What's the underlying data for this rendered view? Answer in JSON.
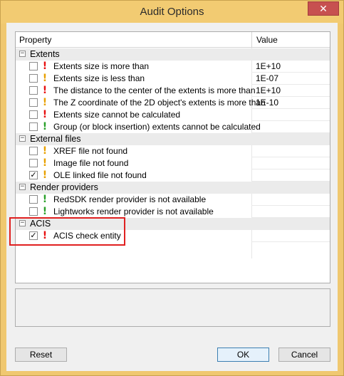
{
  "window": {
    "title": "Audit Options",
    "close_label": "✕"
  },
  "grid": {
    "columns": {
      "property": "Property",
      "value": "Value"
    },
    "groups": [
      {
        "label": "Extents",
        "expander": "−",
        "items": [
          {
            "label": "Extents size is more than",
            "value": "1E+10",
            "checked": "",
            "severity": "error"
          },
          {
            "label": "Extents size is less than",
            "value": "1E-07",
            "checked": "",
            "severity": "warning"
          },
          {
            "label": "The distance to the center of the extents is more than",
            "value": "1E+10",
            "checked": "",
            "severity": "error"
          },
          {
            "label": "The Z coordinate of the 2D object's extents is more than",
            "value": "1E-10",
            "checked": "",
            "severity": "warning"
          },
          {
            "label": "Extents size cannot be calculated",
            "value": "",
            "checked": "",
            "severity": "error"
          },
          {
            "label": "Group (or block insertion) extents cannot be calculated",
            "value": "",
            "checked": "",
            "severity": "info"
          }
        ]
      },
      {
        "label": "External files",
        "expander": "−",
        "items": [
          {
            "label": "XREF file not found",
            "value": "",
            "checked": "",
            "severity": "warning"
          },
          {
            "label": "Image file not found",
            "value": "",
            "checked": "",
            "severity": "warning"
          },
          {
            "label": "OLE linked file not found",
            "value": "",
            "checked": "✓",
            "severity": "warning"
          }
        ]
      },
      {
        "label": "Render providers",
        "expander": "−",
        "items": [
          {
            "label": "RedSDK render provider is not available",
            "value": "",
            "checked": "",
            "severity": "info"
          },
          {
            "label": "Lightworks render provider is not available",
            "value": "",
            "checked": "",
            "severity": "info"
          }
        ]
      },
      {
        "label": "ACIS",
        "expander": "−",
        "items": [
          {
            "label": "ACIS check entity",
            "value": "",
            "checked": "✓",
            "severity": "error"
          }
        ]
      }
    ],
    "severity_glyph": "!"
  },
  "description": "",
  "buttons": {
    "reset": "Reset",
    "ok": "OK",
    "cancel": "Cancel"
  },
  "colors": {
    "error": "#e81010",
    "warning": "#e8a000",
    "info": "#2aa02a",
    "highlight": "#e02020",
    "titlebar": "#f2cb72"
  }
}
